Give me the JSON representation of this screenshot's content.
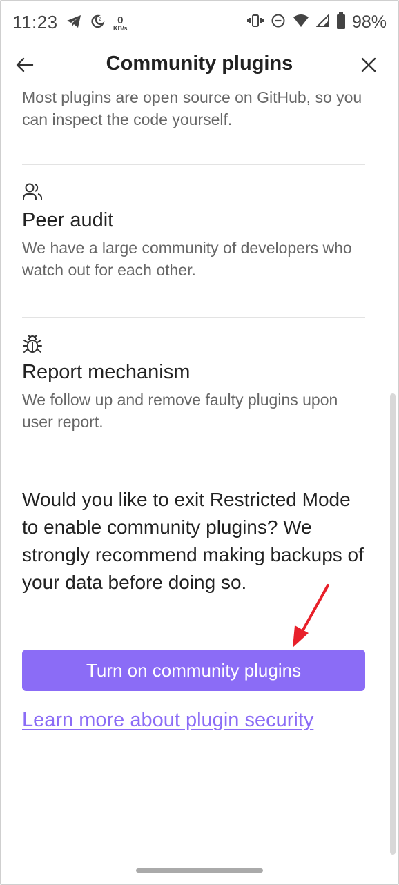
{
  "status_bar": {
    "time": "11:23",
    "net_speed_value": "0",
    "net_speed_unit": "KB/s",
    "battery": "98%"
  },
  "header": {
    "title": "Community plugins"
  },
  "sections": {
    "open_source_desc": "Most plugins are open source on GitHub, so you can inspect the code yourself.",
    "peer_audit": {
      "title": "Peer audit",
      "description": "We have a large community of developers who watch out for each other."
    },
    "report": {
      "title": "Report mechanism",
      "description": "We follow up and remove faulty plugins upon user report."
    }
  },
  "prompt": "Would you like to exit Restricted Mode to enable community plugins? We strongly recommend making backups of your data before doing so.",
  "cta_label": "Turn on community plugins",
  "learn_more_label": "Learn more about plugin security",
  "colors": {
    "accent": "#8b6cf6",
    "annotation_arrow": "#e8202a"
  }
}
